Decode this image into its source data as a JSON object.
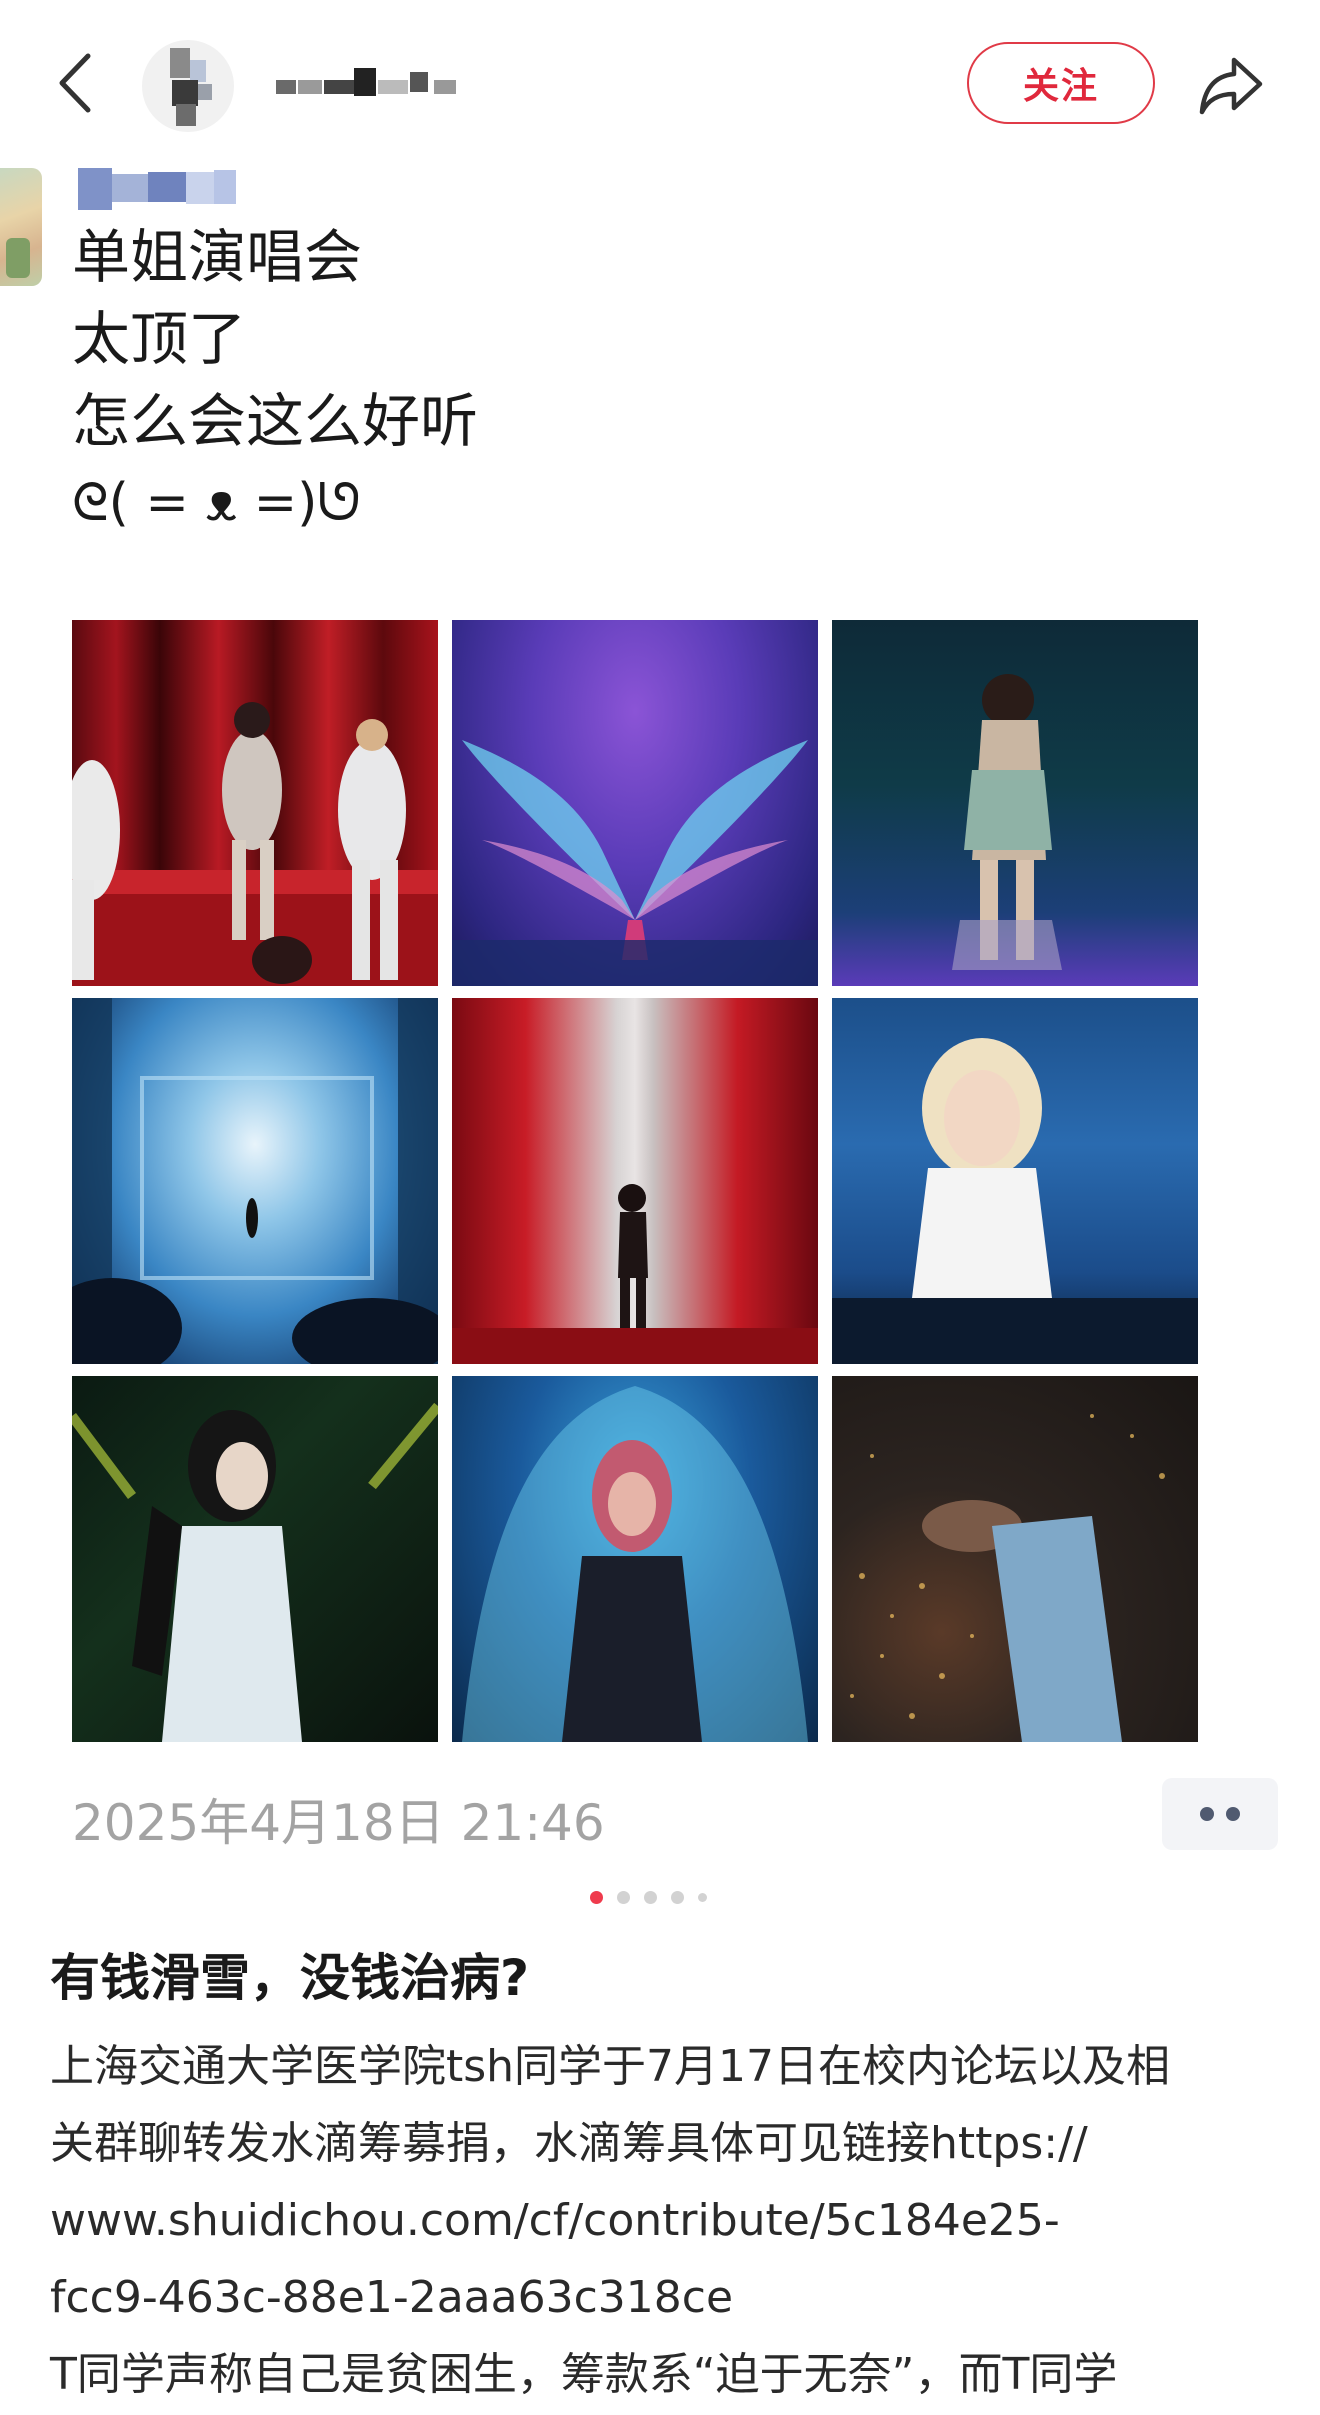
{
  "header": {
    "back_icon": "chevron-left-icon",
    "follow_label": "关注",
    "share_icon": "share-arrow-icon",
    "accent_color": "#e0283c"
  },
  "post": {
    "lines": [
      "单姐演唱会",
      "太顶了",
      "怎么会这么好听",
      "ᘓ( = ᴥ =)ᘎ"
    ],
    "timestamp": "2025年4月18日 21:46",
    "photo_count": 9
  },
  "pager": {
    "total": 5,
    "active_index": 0
  },
  "article": {
    "title": "有钱滑雪，没钱治病?",
    "body_lines": [
      "上海交通大学医学院tsh同学于7月17日在校内论坛以及相",
      "关群聊转发水滴筹募捐，水滴筹具体可见链接https://",
      "www.shuidichou.com/cf/contribute/5c184e25-",
      "fcc9-463c-88e1-2aaa63c318ce",
      "T同学声称自己是贫困生，筹款系“迫于无奈”，而T同学"
    ]
  }
}
